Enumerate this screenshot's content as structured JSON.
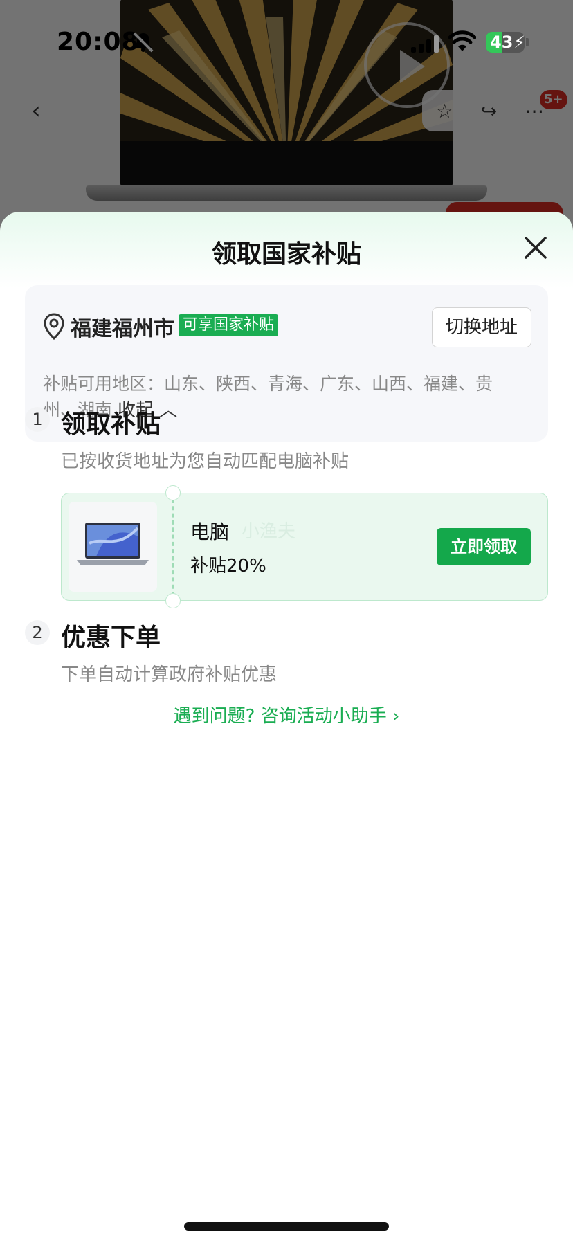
{
  "status_bar": {
    "time": "20:08",
    "battery": "43",
    "battery_level": 0.43
  },
  "background": {
    "back_icon": "chevron-left-icon",
    "actions": [
      "star-icon",
      "share-icon",
      "more-icon"
    ],
    "cart_badge": "5+"
  },
  "sheet": {
    "title": "领取国家补贴",
    "address": {
      "city": "福建福州市",
      "badge": "可享国家补贴",
      "switch_label": "切换地址",
      "regions_label": "补贴可用地区：山东、陕西、青海、广东、山西、福建、贵州、湖南",
      "collapse_label": "收起"
    },
    "steps": [
      {
        "num": "1",
        "title": "领取补贴",
        "desc": "已按收货地址为您自动匹配电脑补贴"
      },
      {
        "num": "2",
        "title": "优惠下单",
        "desc": "下单自动计算政府补贴优惠"
      }
    ],
    "coupon": {
      "name": "电脑",
      "watermark": "小渔夫",
      "rate": "补贴20%",
      "claim_label": "立即领取"
    },
    "help_link": "遇到问题? 咨询活动小助手"
  },
  "colors": {
    "accent": "#1aad52",
    "button": "#14a84b",
    "badge_red": "#e02e24"
  }
}
